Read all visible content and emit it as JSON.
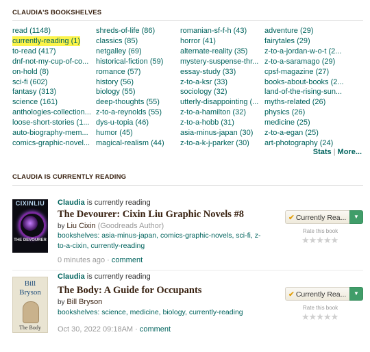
{
  "bookshelves_header": "CLAUDIA'S BOOKSHELVES",
  "shelf_columns": [
    [
      "read (1148)",
      "currently-reading (1)",
      "to-read (417)",
      "dnf-not-my-cup-of-co...",
      "on-hold (8)",
      "sci-fi (602)",
      "fantasy (313)",
      "science (161)",
      "anthologies-collection...",
      "loose-short-stories (1...",
      "auto-biography-mem...",
      "comics-graphic-novel..."
    ],
    [
      "shreds-of-life (86)",
      "classics (85)",
      "netgalley (69)",
      "historical-fiction (59)",
      "romance (57)",
      "history (56)",
      "biology (55)",
      "deep-thoughts (55)",
      "z-to-a-reynolds (55)",
      "dys-u-topia (46)",
      "humor (45)",
      "magical-realism (44)"
    ],
    [
      "romanian-sf-f-h (43)",
      "horror (41)",
      "alternate-reality (35)",
      "mystery-suspense-thr...",
      "essay-study (33)",
      "z-to-a-ksr (33)",
      "sociology (32)",
      "utterly-disappointing (...",
      "z-to-a-hamilton (32)",
      "z-to-a-hobb (31)",
      "asia-minus-japan (30)",
      "z-to-a-k-j-parker (30)"
    ],
    [
      "adventure (29)",
      "fairytales (29)",
      "z-to-a-jordan-w-o-t (2...",
      "z-to-a-saramago (29)",
      "cpsf-magazine (27)",
      "books-about-books (2...",
      "land-of-the-rising-sun...",
      "myths-related (26)",
      "physics (26)",
      "medicine (25)",
      "z-to-a-egan (25)",
      "art-photography (24)"
    ]
  ],
  "stats_link": "Stats",
  "stats_separator": "|",
  "more_link": "More...",
  "currently_reading_header": "CLAUDIA IS CURRENTLY READING",
  "books": [
    {
      "user": "Claudia",
      "status_text": " is currently reading",
      "title": "The Devourer: Cixin Liu Graphic Novels #8",
      "by": "by ",
      "author": "Liu Cixin",
      "author_note": " (Goodreads Author)",
      "bookshelves_label": "bookshelves: ",
      "bookshelves": "asia-minus-japan, comics-graphic-novels, sci-fi, z-to-a-cixin, currently-reading",
      "time": "0 minutes ago",
      "dot": " · ",
      "comment": "comment",
      "button_label": "Currently Rea...",
      "rate_label": "Rate this book",
      "cover_title": "CIXINLIU",
      "cover_subtitle": "THE DEVOURER"
    },
    {
      "user": "Claudia",
      "status_text": " is currently reading",
      "title": "The Body: A Guide for Occupants",
      "by": "by ",
      "author": "Bill Bryson",
      "author_note": "",
      "bookshelves_label": "bookshelves: ",
      "bookshelves": "science, medicine, biology, currently-reading",
      "time": "Oct 30, 2022 09:18AM",
      "dot": " · ",
      "comment": "comment",
      "button_label": "Currently Rea...",
      "rate_label": "Rate this book",
      "cover_author_first": "Bill",
      "cover_author_last": "Bryson",
      "cover_title": "The Body"
    }
  ],
  "stars": "★★★★★",
  "checkmark": "✔",
  "dropdown_arrow": "▼",
  "colors": {
    "link": "#00635d",
    "highlight": "#fbf34a",
    "button_green": "#409d69",
    "heading": "#382110"
  },
  "icons": [
    "check-icon",
    "dropdown-arrow-icon",
    "star-icon"
  ]
}
